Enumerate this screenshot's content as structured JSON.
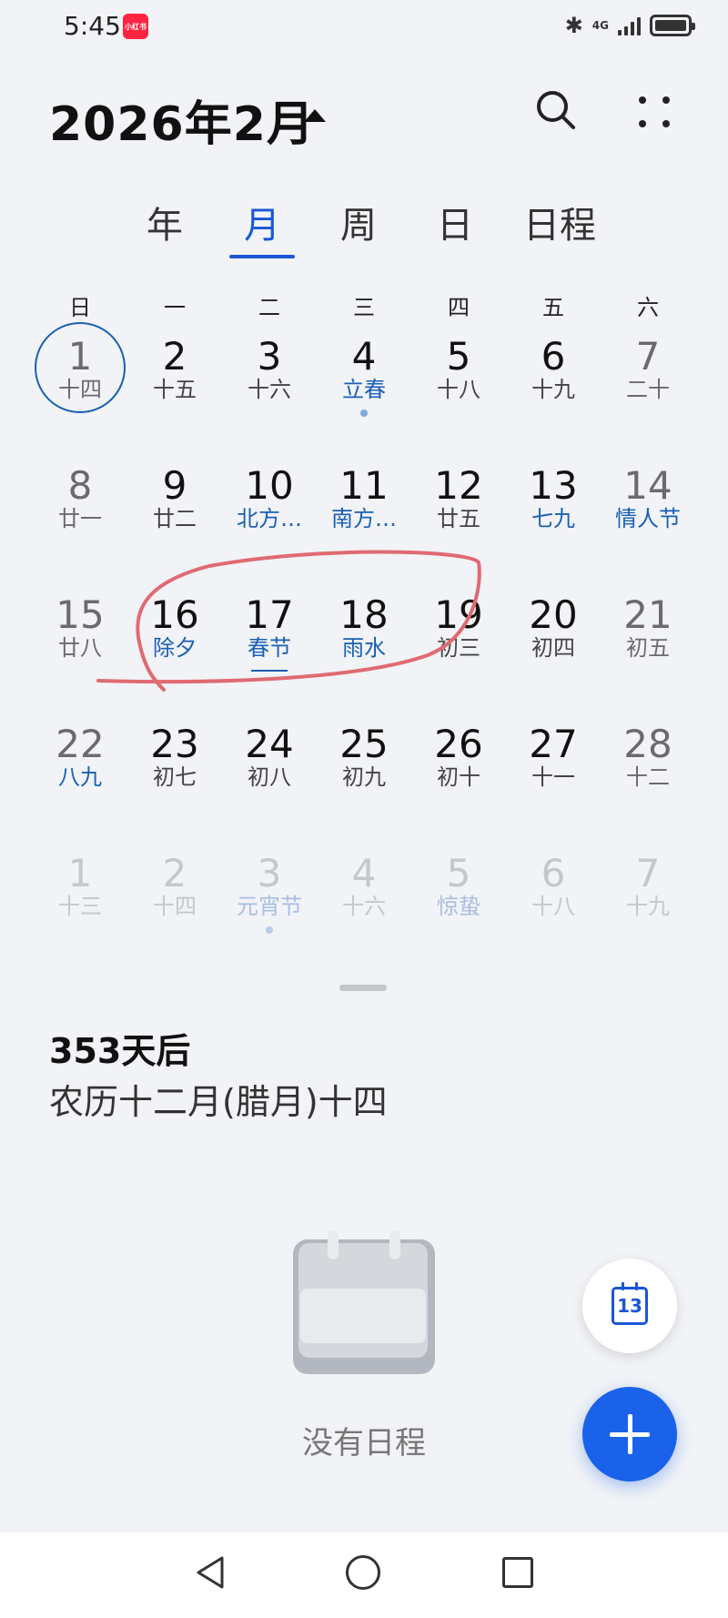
{
  "status_bar": {
    "time": "5:45",
    "app_badge": "小红书",
    "network": "4G"
  },
  "header": {
    "title": "2026年2月"
  },
  "view_tabs": [
    {
      "label": "年",
      "active": false
    },
    {
      "label": "月",
      "active": true
    },
    {
      "label": "周",
      "active": false
    },
    {
      "label": "日",
      "active": false
    },
    {
      "label": "日程",
      "active": false
    }
  ],
  "weekdays": [
    "日",
    "一",
    "二",
    "三",
    "四",
    "五",
    "六"
  ],
  "weeks": [
    [
      {
        "day": "1",
        "lunar": "十四",
        "today": true
      },
      {
        "day": "2",
        "lunar": "十五"
      },
      {
        "day": "3",
        "lunar": "十六"
      },
      {
        "day": "4",
        "lunar": "立春",
        "festival": true,
        "dot": true
      },
      {
        "day": "5",
        "lunar": "十八"
      },
      {
        "day": "6",
        "lunar": "十九"
      },
      {
        "day": "7",
        "lunar": "二十"
      }
    ],
    [
      {
        "day": "8",
        "lunar": "廿一"
      },
      {
        "day": "9",
        "lunar": "廿二"
      },
      {
        "day": "10",
        "lunar": "北方…",
        "festival": true
      },
      {
        "day": "11",
        "lunar": "南方…",
        "festival": true
      },
      {
        "day": "12",
        "lunar": "廿五"
      },
      {
        "day": "13",
        "lunar": "七九",
        "festival": true
      },
      {
        "day": "14",
        "lunar": "情人节",
        "festival": true
      }
    ],
    [
      {
        "day": "15",
        "lunar": "廿八"
      },
      {
        "day": "16",
        "lunar": "除夕",
        "festival": true
      },
      {
        "day": "17",
        "lunar": "春节",
        "festival": true,
        "underline": true
      },
      {
        "day": "18",
        "lunar": "雨水",
        "festival": true
      },
      {
        "day": "19",
        "lunar": "初三"
      },
      {
        "day": "20",
        "lunar": "初四"
      },
      {
        "day": "21",
        "lunar": "初五"
      }
    ],
    [
      {
        "day": "22",
        "lunar": "八九",
        "festival": true
      },
      {
        "day": "23",
        "lunar": "初七"
      },
      {
        "day": "24",
        "lunar": "初八"
      },
      {
        "day": "25",
        "lunar": "初九"
      },
      {
        "day": "26",
        "lunar": "初十"
      },
      {
        "day": "27",
        "lunar": "十一"
      },
      {
        "day": "28",
        "lunar": "十二"
      }
    ],
    [
      {
        "day": "1",
        "lunar": "十三",
        "other": true
      },
      {
        "day": "2",
        "lunar": "十四",
        "other": true
      },
      {
        "day": "3",
        "lunar": "元宵节",
        "other": true,
        "festival": true,
        "dot": true
      },
      {
        "day": "4",
        "lunar": "十六",
        "other": true
      },
      {
        "day": "5",
        "lunar": "惊蛰",
        "other": true,
        "festival": true
      },
      {
        "day": "6",
        "lunar": "十八",
        "other": true
      },
      {
        "day": "7",
        "lunar": "十九",
        "other": true
      }
    ]
  ],
  "detail": {
    "days_after": "353天后",
    "lunar_date": "农历十二月(腊月)十四"
  },
  "empty_state": {
    "text": "没有日程"
  },
  "today_button": {
    "day": "13"
  },
  "colors": {
    "accent": "#1a56d6",
    "festival": "#1a5fb4",
    "add_fab": "#1b62ea",
    "annotation": "#e06a72"
  }
}
